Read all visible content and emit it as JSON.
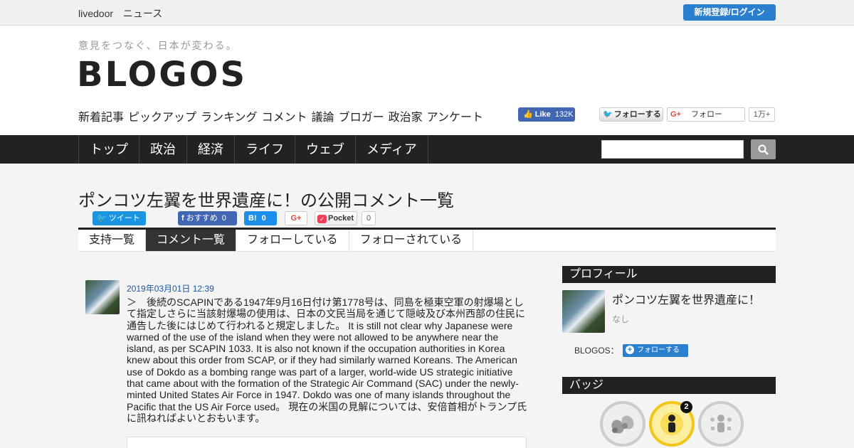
{
  "topbar": {
    "brand_livedoor": "livedoor",
    "brand_news": "ニュース",
    "login_label": "新規登録/ログイン"
  },
  "header": {
    "tagline": "意見をつなぐ、日本が変わる。",
    "logo": "BLOGOS",
    "subnav": [
      "新着記事",
      "ピックアップ",
      "ランキング",
      "コメント",
      "議論",
      "ブロガー",
      "政治家",
      "アンケート"
    ],
    "fb_like_label": "Like",
    "fb_like_count": "132K",
    "tw_follow_label": "フォローする",
    "gp_follow_label": "フォロー",
    "gp_follow_count": "1万+"
  },
  "mainnav": {
    "items": [
      "トップ",
      "政治",
      "経済",
      "ライフ",
      "ウェブ",
      "メディア"
    ],
    "search_placeholder": ""
  },
  "page": {
    "title": "ポンコツ左翼を世界遺産に！の公開コメント一覧",
    "share": {
      "tweet": "ツイート",
      "fb_label": "おすすめ",
      "fb_count": "0",
      "hatena_label": "B!",
      "hatena_count": "0",
      "gplus": "G+",
      "pocket": "Pocket",
      "pocket_count": "0"
    },
    "tabs": [
      "支持一覧",
      "コメント一覧",
      "フォローしている",
      "フォローされている"
    ],
    "active_tab": "コメント一覧"
  },
  "comment": {
    "date": "2019年03月01日 12:39",
    "body": "＞　後続のSCAPINである1947年9月16日付け第1778号は、同島を極東空軍の射爆場として指定しさらに当該射爆場の使用は、日本の文民当局を通じて隠岐及び本州西部の住民に通告した後にはじめて行われると規定しました。 It is still not clear why Japanese were warned of the use of the island when they were not allowed to be anywhere near the island, as per SCAPIN 1033. It is also not known if the occupation authorities in Korea knew about this order from SCAP, or if they had similarly warned Koreans. The American use of Dokdo as a bombing range was part of a larger, world-wide US strategic initiative that came about with the formation of the Strategic Air Command (SAC) under the newly-minted United States Air Force in 1947. Dokdo was one of many islands throughout the Pacific that the US Air Force used。 現在の米国の見解については、安倍首相がトランプ氏に訊ねればよいとおもいます。"
  },
  "sidebar": {
    "profile_heading": "プロフィール",
    "profile_name": "ポンコツ左翼を世界遺産に！",
    "profile_desc": "なし",
    "blogos_label": "BLOGOS：",
    "follow_label": "フォローする",
    "badge_heading": "バッジ",
    "badge_count": "2"
  }
}
